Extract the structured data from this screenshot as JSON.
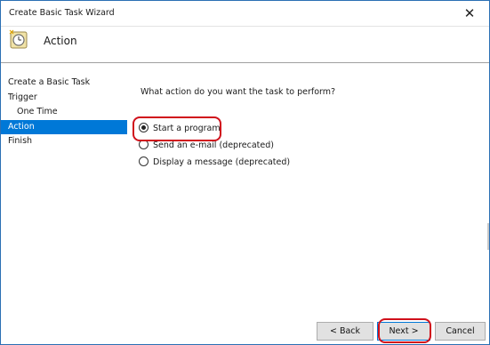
{
  "window": {
    "title": "Create Basic Task Wizard"
  },
  "header": {
    "title": "Action",
    "icon": "clock-icon"
  },
  "sidebar": {
    "items": [
      {
        "label": "Create a Basic Task"
      },
      {
        "label": "Trigger"
      },
      {
        "label": "One Time"
      },
      {
        "label": "Action"
      },
      {
        "label": "Finish"
      }
    ]
  },
  "main": {
    "question": "What action do you want the task to perform?",
    "options": [
      {
        "label": "Start a program",
        "selected": true
      },
      {
        "label": "Send an e-mail (deprecated)",
        "selected": false
      },
      {
        "label": "Display a message (deprecated)",
        "selected": false
      }
    ]
  },
  "buttons": {
    "back": "< Back",
    "next": "Next >",
    "cancel": "Cancel"
  },
  "colors": {
    "accent": "#0078d7",
    "highlight": "#d0101b"
  }
}
